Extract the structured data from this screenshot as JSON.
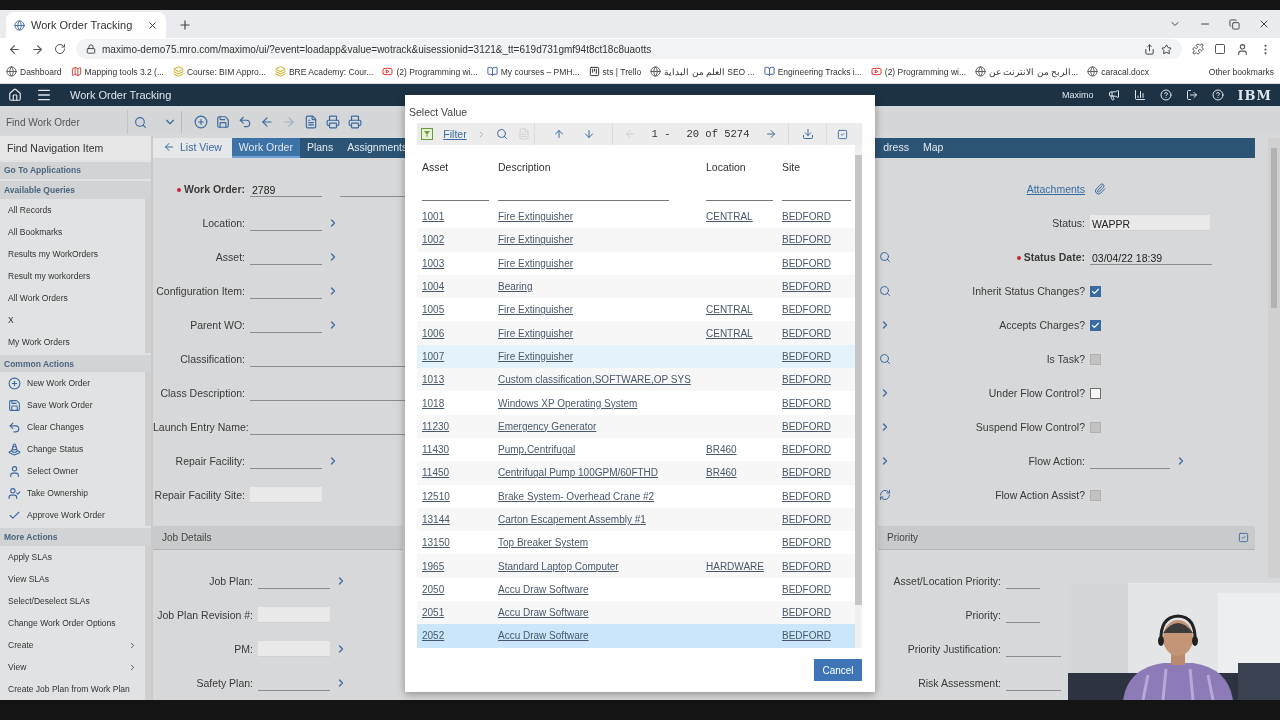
{
  "browser": {
    "tab_title": "Work Order Tracking",
    "url": "maximo-demo75.mro.com/maximo/ui/?event=loadapp&value=wotrack&uisessionid=3121&_tt=619d731gmf94t8ct18c8uaotts",
    "bookmarks": [
      {
        "label": "Dashboard",
        "kind": "globe"
      },
      {
        "label": "Mapping tools 3.2 (...",
        "kind": "map"
      },
      {
        "label": "Course: BIM Appro...",
        "kind": "bre"
      },
      {
        "label": "BRE Academy: Cour...",
        "kind": "bre"
      },
      {
        "label": "(2) Programming wi...",
        "kind": "video"
      },
      {
        "label": "My courses – PMH...",
        "kind": "course"
      },
      {
        "label": "sts | Trello",
        "kind": "board"
      },
      {
        "label": "العلم من البداية SEO ...",
        "kind": "globe"
      },
      {
        "label": "Engineering Tracks i...",
        "kind": "course"
      },
      {
        "label": "(2) Programming wi...",
        "kind": "video"
      },
      {
        "label": "الربح من الانترنت عن...",
        "kind": "globe"
      },
      {
        "label": "caracal.docx",
        "kind": "globe"
      }
    ],
    "other_bookmarks": "Other bookmarks"
  },
  "app_header": {
    "title": "Work Order Tracking",
    "user": "Maximo",
    "brand": "IBM"
  },
  "toolbar": {
    "search_placeholder": "Find Work Order"
  },
  "sidebar": {
    "find_item": "Find Navigation Item",
    "sections": [
      {
        "title": "Go To Applications"
      },
      {
        "title": "Available Queries",
        "items": [
          {
            "label": "All Records"
          },
          {
            "label": "All Bookmarks"
          },
          {
            "label": "Results my WorkOrders"
          },
          {
            "label": "Result my workorders"
          },
          {
            "label": "All Work Orders"
          },
          {
            "label": "X"
          },
          {
            "label": "My Work Orders"
          }
        ]
      },
      {
        "title": "Common Actions",
        "items": [
          {
            "label": "New Work Order",
            "kind": "new"
          },
          {
            "label": "Save Work Order",
            "kind": "save"
          },
          {
            "label": "Clear Changes",
            "kind": "clear"
          },
          {
            "label": "Change Status",
            "kind": "status"
          },
          {
            "label": "Select Owner",
            "kind": "owner"
          },
          {
            "label": "Take Ownership",
            "kind": "ownership"
          },
          {
            "label": "Approve Work Order",
            "kind": "approve"
          }
        ]
      },
      {
        "title": "More Actions",
        "items": [
          {
            "label": "Apply SLAs",
            "submenu": false
          },
          {
            "label": "View SLAs",
            "submenu": false
          },
          {
            "label": "Select/Deselect SLAs",
            "submenu": false
          },
          {
            "label": "Change Work Order Options",
            "submenu": false
          },
          {
            "label": "Create",
            "submenu": true
          },
          {
            "label": "View",
            "submenu": true
          },
          {
            "label": "Create Job Plan from Work Plan",
            "submenu": false
          }
        ]
      }
    ]
  },
  "tabs": [
    {
      "label": "List View",
      "kind": "back",
      "selected": false
    },
    {
      "label": "Work Order",
      "kind": "tab",
      "selected": true
    },
    {
      "label": "Plans",
      "kind": "tab",
      "selected": false
    },
    {
      "label": "Assignments",
      "kind": "tab",
      "selected": false
    },
    {
      "label": "dress",
      "kind": "far",
      "selected": false
    },
    {
      "label": "Map",
      "kind": "far",
      "selected": false
    }
  ],
  "form": {
    "left_fields": [
      {
        "label": "Work Order:",
        "required": true,
        "value": "2789",
        "kind": "pair",
        "arrow": false
      },
      {
        "label": "Location:",
        "required": false,
        "kind": "short",
        "arrow": true
      },
      {
        "label": "Asset:",
        "required": false,
        "kind": "short",
        "arrow": true
      },
      {
        "label": "Configuration Item:",
        "required": false,
        "kind": "short",
        "arrow": true
      },
      {
        "label": "Parent WO:",
        "required": false,
        "kind": "short",
        "arrow": true
      },
      {
        "label": "Classification:",
        "required": false,
        "kind": "long",
        "arrow": false
      },
      {
        "label": "Class Description:",
        "required": false,
        "kind": "long",
        "arrow": false
      },
      {
        "label": "Launch Entry Name:",
        "required": false,
        "kind": "long",
        "arrow": false
      },
      {
        "label": "Repair Facility:",
        "required": false,
        "kind": "short",
        "arrow": true
      },
      {
        "label": "Repair Facility Site:",
        "required": false,
        "kind": "readonly",
        "arrow": false
      }
    ],
    "middle_icons": [
      {
        "kind": "none"
      },
      {
        "kind": "none"
      },
      {
        "kind": "search"
      },
      {
        "kind": "search"
      },
      {
        "kind": "arrow"
      },
      {
        "kind": "search"
      },
      {
        "kind": "arrow"
      },
      {
        "kind": "arrow"
      },
      {
        "kind": "arrow"
      },
      {
        "kind": "refresh"
      }
    ],
    "right_fields": [
      {
        "kind": "link",
        "label": "Attachments"
      },
      {
        "kind": "text",
        "label": "Status:",
        "value": "WAPPR"
      },
      {
        "kind": "date",
        "label": "Status Date:",
        "required": true,
        "value": "03/04/22 18:39"
      },
      {
        "kind": "checkbox",
        "label": "Inherit Status Changes?",
        "checked": true,
        "disabled": false
      },
      {
        "kind": "checkbox",
        "label": "Accepts Charges?",
        "checked": true,
        "disabled": false
      },
      {
        "kind": "checkbox",
        "label": "Is Task?",
        "checked": false,
        "disabled": true
      },
      {
        "kind": "checkbox",
        "label": "Under Flow Control?",
        "checked": false,
        "disabled": false
      },
      {
        "kind": "checkbox",
        "label": "Suspend Flow Control?",
        "checked": false,
        "disabled": true
      },
      {
        "kind": "lookup",
        "label": "Flow Action:"
      },
      {
        "kind": "checkbox",
        "label": "Flow Action Assist?",
        "checked": false,
        "disabled": true
      }
    ],
    "job_details": {
      "title": "Job Details",
      "fields": [
        {
          "label": "Job Plan:",
          "kind": "short",
          "arrow": true
        },
        {
          "label": "Job Plan Revision #:",
          "kind": "readonly",
          "arrow": false
        },
        {
          "label": "PM:",
          "kind": "readonly",
          "arrow": true
        },
        {
          "label": "Safety Plan:",
          "kind": "short",
          "arrow": true
        }
      ]
    },
    "priority": {
      "title": "Priority",
      "fields": [
        {
          "label": "Asset/Location Priority:",
          "kind": "short"
        },
        {
          "label": "Priority:",
          "kind": "short"
        },
        {
          "label": "Priority Justification:",
          "kind": "long"
        },
        {
          "label": "Risk Assessment:",
          "kind": "long"
        }
      ]
    }
  },
  "dialog": {
    "title": "Select Value",
    "filter": "Filter",
    "range_start": "1 -",
    "range_end": "20 of 5274",
    "columns": [
      "Asset",
      "Description",
      "Location",
      "Site"
    ],
    "rows": [
      {
        "asset": "1001",
        "description": "Fire Extinguisher",
        "location": "CENTRAL",
        "site": "BEDFORD",
        "hovered": false,
        "selected": false
      },
      {
        "asset": "1002",
        "description": "Fire Extinguisher",
        "site": "BEDFORD",
        "hovered": false,
        "selected": false
      },
      {
        "asset": "1003",
        "description": "Fire Extinguisher",
        "site": "BEDFORD",
        "hovered": false,
        "selected": false
      },
      {
        "asset": "1004",
        "description": "Bearing",
        "site": "BEDFORD",
        "hovered": false,
        "selected": false
      },
      {
        "asset": "1005",
        "description": "Fire Extinguisher",
        "location": "CENTRAL",
        "site": "BEDFORD",
        "hovered": false,
        "selected": false
      },
      {
        "asset": "1006",
        "description": "Fire Extinguisher",
        "location": "CENTRAL",
        "site": "BEDFORD",
        "hovered": false,
        "selected": false
      },
      {
        "asset": "1007",
        "description": "Fire Extinguisher",
        "site": "BEDFORD",
        "hovered": true,
        "selected": false
      },
      {
        "asset": "1013",
        "description": "Custom classification,SOFTWARE,OP SYS",
        "site": "BEDFORD",
        "hovered": false,
        "selected": false
      },
      {
        "asset": "1018",
        "description": "Windows XP Operating System",
        "site": "BEDFORD",
        "hovered": false,
        "selected": false
      },
      {
        "asset": "11230",
        "description": "Emergency Generator",
        "site": "BEDFORD",
        "hovered": false,
        "selected": false
      },
      {
        "asset": "11430",
        "description": "Pump,Centrifugal",
        "location": "BR460",
        "site": "BEDFORD",
        "hovered": false,
        "selected": false
      },
      {
        "asset": "11450",
        "description": "Centrifugal Pump 100GPM/60FTHD",
        "location": "BR460",
        "site": "BEDFORD",
        "hovered": false,
        "selected": false
      },
      {
        "asset": "12510",
        "description": "Brake System- Overhead Crane #2",
        "site": "BEDFORD",
        "hovered": false,
        "selected": false
      },
      {
        "asset": "13144",
        "description": "Carton Escapement Assembly #1",
        "site": "BEDFORD",
        "hovered": false,
        "selected": false
      },
      {
        "asset": "13150",
        "description": "Top Breaker System",
        "site": "BEDFORD",
        "hovered": false,
        "selected": false
      },
      {
        "asset": "1965",
        "description": "Standard Laptop Computer",
        "location": "HARDWARE",
        "site": "BEDFORD",
        "hovered": false,
        "selected": false
      },
      {
        "asset": "2050",
        "description": "Accu Draw Software",
        "site": "BEDFORD",
        "hovered": false,
        "selected": false
      },
      {
        "asset": "2051",
        "description": "Accu Draw Software",
        "site": "BEDFORD",
        "hovered": false,
        "selected": false
      },
      {
        "asset": "2052",
        "description": "Accu Draw Software",
        "site": "BEDFORD",
        "hovered": false,
        "selected": true
      }
    ],
    "cancel": "Cancel"
  }
}
